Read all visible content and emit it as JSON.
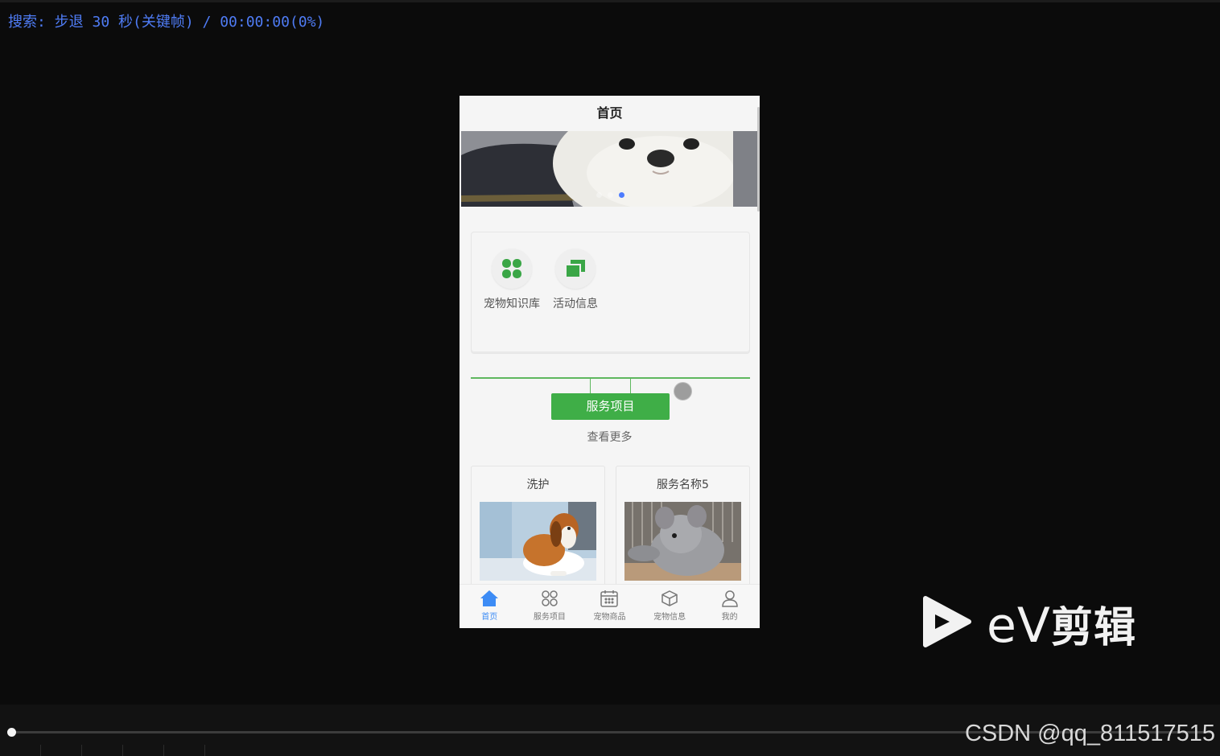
{
  "osd": {
    "text": "搜索: 步退 30 秒(关键帧) / 00:00:00(0%)"
  },
  "phone": {
    "title": "首页",
    "banner": {
      "slides": 3,
      "active_slide": 3
    },
    "categories": [
      {
        "label": "宠物知识库",
        "icon": "clover-icon"
      },
      {
        "label": "活动信息",
        "icon": "folders-icon"
      }
    ],
    "section": {
      "button_label": "服务项目",
      "more_label": "查看更多"
    },
    "services": [
      {
        "name": "洗护",
        "image": "beagle-dog-photo"
      },
      {
        "name": "服务名称5",
        "image": "chinchilla-photo"
      }
    ],
    "tabs": [
      {
        "label": "首页",
        "icon": "home-icon",
        "active": true
      },
      {
        "label": "服务项目",
        "icon": "command-icon",
        "active": false
      },
      {
        "label": "宠物商品",
        "icon": "calendar-icon",
        "active": false
      },
      {
        "label": "宠物信息",
        "icon": "box-icon",
        "active": false
      },
      {
        "label": "我的",
        "icon": "user-icon",
        "active": false
      }
    ]
  },
  "watermark": {
    "brand_latin": "eV",
    "brand_han": "剪辑",
    "credit": "CSDN @qq_811517515"
  },
  "player": {
    "progress": 0.0
  },
  "colors": {
    "accent_green": "#3fae47",
    "tab_active": "#3d8cf5",
    "osd_blue": "#4f7cf5"
  }
}
